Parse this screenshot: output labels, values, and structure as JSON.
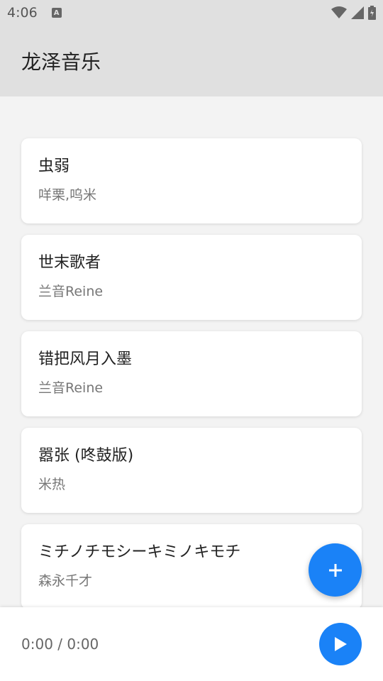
{
  "status_bar": {
    "time": "4:06",
    "notification_badge": "A"
  },
  "app_bar": {
    "title": "龙泽音乐"
  },
  "songs": [
    {
      "title": "虫弱",
      "artist": "咩栗,呜米"
    },
    {
      "title": "世末歌者",
      "artist": "兰音Reine"
    },
    {
      "title": "错把风月入墨",
      "artist": "兰音Reine"
    },
    {
      "title": "嚣张 (咚鼓版)",
      "artist": "米热"
    },
    {
      "title": "ミチノチモシーキミノキモチ",
      "artist": "森永千才"
    }
  ],
  "player": {
    "time_display": "0:00 / 0:00"
  },
  "colors": {
    "accent": "#1a82f7",
    "app_bar_bg": "#e0e0e0"
  },
  "icons": {
    "fab": "plus-icon",
    "play": "play-icon"
  }
}
